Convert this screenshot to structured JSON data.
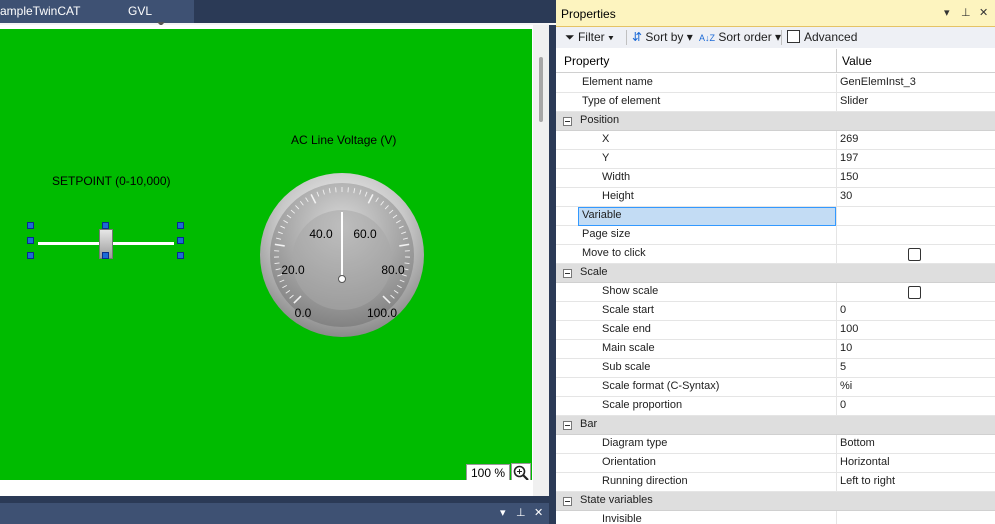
{
  "editor": {
    "tabs": [
      {
        "label": "ampleTwinCAT"
      },
      {
        "label": "GVL"
      }
    ],
    "canvas": {
      "background": "#00bb00",
      "setpoint_label": "SETPOINT (0-10,000)",
      "gauge_title": "AC Line Voltage (V)",
      "gauge_ticks": [
        "0.0",
        "20.0",
        "40.0",
        "60.0",
        "80.0",
        "100.0"
      ],
      "gauge_value": 50
    },
    "zoom": "100 %"
  },
  "properties": {
    "title": "Properties",
    "title_icons": [
      "pin-dropdown-icon",
      "pin-icon",
      "close-icon"
    ],
    "toolbar": {
      "filter": "Filter",
      "sort_by": "Sort by",
      "sort_order": "Sort order",
      "advanced": "Advanced",
      "advanced_checked": false
    },
    "columns": {
      "property": "Property",
      "value": "Value"
    },
    "rows": [
      {
        "type": "prop",
        "level": 1,
        "name": "Element name",
        "value": "GenElemInst_3"
      },
      {
        "type": "prop",
        "level": 1,
        "name": "Type of element",
        "value": "Slider"
      },
      {
        "type": "cat",
        "name": "Position"
      },
      {
        "type": "prop",
        "level": 2,
        "name": "X",
        "value": "269"
      },
      {
        "type": "prop",
        "level": 2,
        "name": "Y",
        "value": "197"
      },
      {
        "type": "prop",
        "level": 2,
        "name": "Width",
        "value": "150"
      },
      {
        "type": "prop",
        "level": 2,
        "name": "Height",
        "value": "30"
      },
      {
        "type": "prop",
        "level": 1,
        "name": "Variable",
        "value": "",
        "selected": true
      },
      {
        "type": "prop",
        "level": 1,
        "name": "Page size",
        "value": ""
      },
      {
        "type": "prop",
        "level": 1,
        "name": "Move to click",
        "value": "",
        "checkbox": false
      },
      {
        "type": "cat",
        "name": "Scale"
      },
      {
        "type": "prop",
        "level": 2,
        "name": "Show scale",
        "value": "",
        "checkbox": false
      },
      {
        "type": "prop",
        "level": 2,
        "name": "Scale start",
        "value": "0"
      },
      {
        "type": "prop",
        "level": 2,
        "name": "Scale end",
        "value": "100"
      },
      {
        "type": "prop",
        "level": 2,
        "name": "Main scale",
        "value": "10"
      },
      {
        "type": "prop",
        "level": 2,
        "name": "Sub scale",
        "value": "5"
      },
      {
        "type": "prop",
        "level": 2,
        "name": "Scale format (C-Syntax)",
        "value": "%i"
      },
      {
        "type": "prop",
        "level": 2,
        "name": "Scale proportion",
        "value": "0"
      },
      {
        "type": "cat",
        "name": "Bar"
      },
      {
        "type": "prop",
        "level": 2,
        "name": "Diagram type",
        "value": "Bottom"
      },
      {
        "type": "prop",
        "level": 2,
        "name": "Orientation",
        "value": "Horizontal"
      },
      {
        "type": "prop",
        "level": 2,
        "name": "Running direction",
        "value": "Left to right"
      },
      {
        "type": "cat",
        "name": "State variables"
      },
      {
        "type": "prop",
        "level": 2,
        "name": "Invisible",
        "value": ""
      }
    ]
  }
}
